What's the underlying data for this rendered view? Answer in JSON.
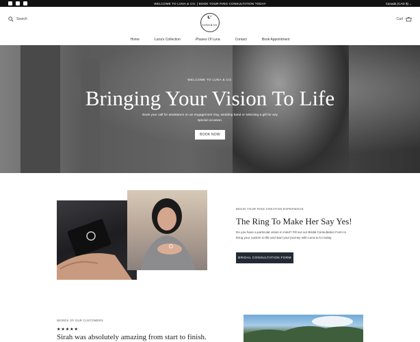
{
  "topbar": {
    "announcement": "WELCOME TO LUNA & CO.  |  BOOK YOUR RING CONSULTATION TODAY",
    "locale": "Canada (CAD $)",
    "social_icons": [
      "facebook-icon",
      "youtube-icon",
      "instagram-icon"
    ]
  },
  "header": {
    "search_label": "Search",
    "logo_text": "LUNA & CO.",
    "cart_label": "Cart"
  },
  "nav": {
    "items": [
      {
        "label": "Home",
        "active": true
      },
      {
        "label": "Luna's Collection",
        "active": false
      },
      {
        "label": "Phases Of Luna",
        "active": false
      },
      {
        "label": "Contact",
        "active": false
      },
      {
        "label": "Book Appointment",
        "active": false
      }
    ]
  },
  "hero": {
    "kicker": "WELCOME TO LUNA & CO.",
    "title": "Bringing Your Vision To Life",
    "subtitle": "Book your call for assistance on an engagement ring, wedding band or selecting a gift for any special occasion.",
    "button": "BOOK NOW"
  },
  "ring_section": {
    "kicker": "BEGIN YOUR RING CREATION EXPERIENCE",
    "title": "The Ring To Make Her Say Yes!",
    "body": "Do you have a particular vision in mind? Fill out our Bridal Consultation Form to bring your custom to life and start your journey with Luna & Co today.",
    "button": "BRIDAL CONSULTATION FORM"
  },
  "testimonial": {
    "kicker": "WORDS OF OUR CUSTOMERS",
    "stars": "★★★★★",
    "quote": "Sirah was absolutely amazing from start to finish."
  },
  "colors": {
    "topbar_bg": "#111111",
    "primary_button": "#222a33"
  }
}
